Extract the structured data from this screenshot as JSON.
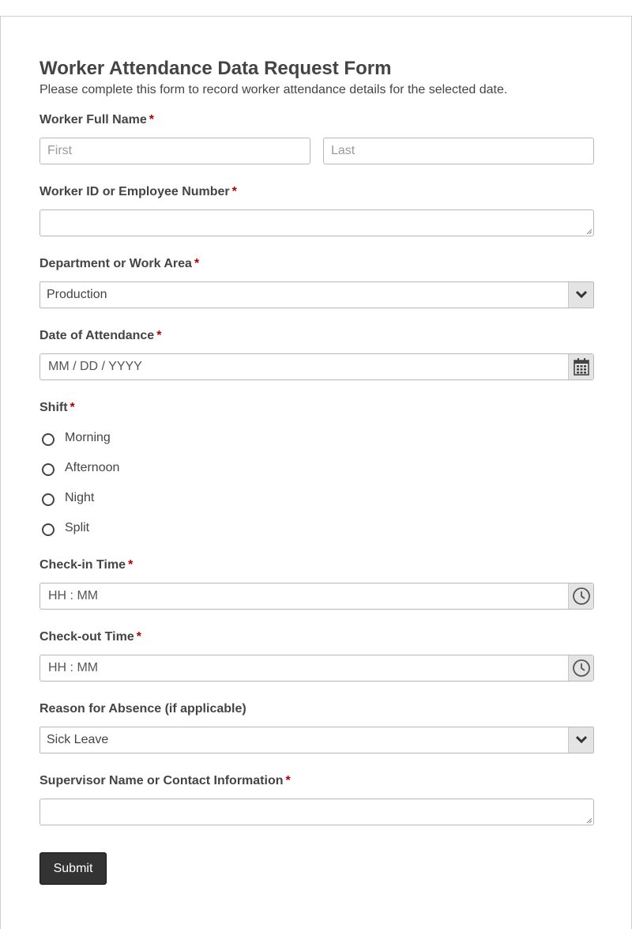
{
  "form": {
    "title": "Worker Attendance Data Request Form",
    "description": "Please complete this form to record worker attendance details for the selected date.",
    "required_marker": "*"
  },
  "fields": {
    "name": {
      "label": "Worker Full Name",
      "first_placeholder": "First",
      "last_placeholder": "Last",
      "first_value": "",
      "last_value": ""
    },
    "worker_id": {
      "label": "Worker ID or Employee Number",
      "value": ""
    },
    "department": {
      "label": "Department or Work Area",
      "selected": "Production"
    },
    "date": {
      "label": "Date of Attendance",
      "placeholder": "MM / DD / YYYY"
    },
    "shift": {
      "label": "Shift",
      "options": [
        "Morning",
        "Afternoon",
        "Night",
        "Split"
      ],
      "selected": null
    },
    "checkin": {
      "label": "Check-in Time",
      "placeholder": "HH : MM"
    },
    "checkout": {
      "label": "Check-out Time",
      "placeholder": "HH : MM"
    },
    "absence": {
      "label": "Reason for Absence (if applicable)",
      "selected": "Sick Leave"
    },
    "supervisor": {
      "label": "Supervisor Name or Contact Information",
      "value": ""
    }
  },
  "submit_label": "Submit",
  "icons": {
    "dropdown": "chevron-down-icon",
    "date": "calendar-icon",
    "time": "clock-icon"
  }
}
